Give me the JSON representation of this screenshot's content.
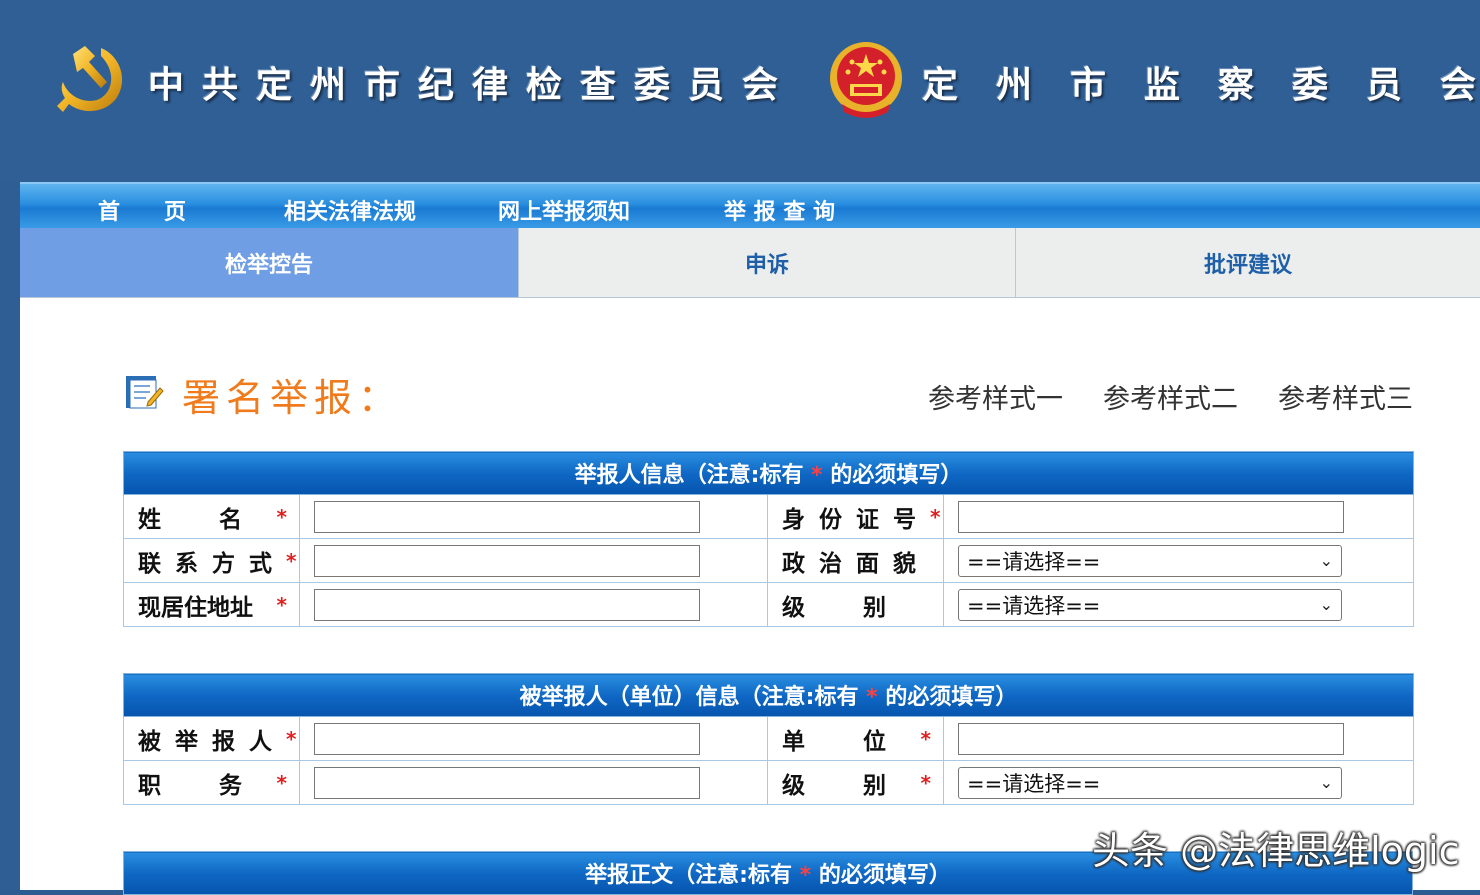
{
  "header": {
    "left_title": "中共定州市纪律检查委员会",
    "right_title": "定州市监察委员会"
  },
  "nav": {
    "items": [
      {
        "label": "首　　页"
      },
      {
        "label": "相关法律法规"
      },
      {
        "label": "网上举报须知"
      },
      {
        "label": "举 报 查 询"
      }
    ]
  },
  "tabs": [
    {
      "label": "检举控告",
      "active": true
    },
    {
      "label": "申诉",
      "active": false
    },
    {
      "label": "批评建议",
      "active": false
    }
  ],
  "section": {
    "title": "署名举报：",
    "samples": [
      "参考样式一",
      "参考样式二",
      "参考样式三"
    ]
  },
  "reporter_table": {
    "caption_prefix": "举报人信息（注意:标有",
    "caption_star": "*",
    "caption_suffix": "的必须填写）",
    "fields": {
      "name_label": "姓　　名",
      "id_label": "身份证号",
      "contact_label": "联系方式",
      "political_label": "政治面貌",
      "political_value": "==请选择==",
      "address_label": "现居住地址",
      "level_label": "级　　别",
      "level_value": "==请选择=="
    }
  },
  "accused_table": {
    "caption_prefix": "被举报人（单位）信息（注意:标有",
    "caption_star": "*",
    "caption_suffix": "的必须填写）",
    "fields": {
      "accused_label": "被举报人",
      "unit_label": "单　　位",
      "duty_label": "职　　务",
      "level_label": "级　　别",
      "level_value": "==请选择=="
    }
  },
  "content_table": {
    "caption_prefix": "举报正文（注意:标有",
    "caption_star": "*",
    "caption_suffix": "的必须填写）"
  },
  "required_star": "*",
  "watermark": "头条 @法律思维logic",
  "colors": {
    "header_bg": "#2f5f95",
    "active_tab": "#6f9ee4",
    "title_orange": "#f07b1c",
    "required_red": "#e02020"
  }
}
